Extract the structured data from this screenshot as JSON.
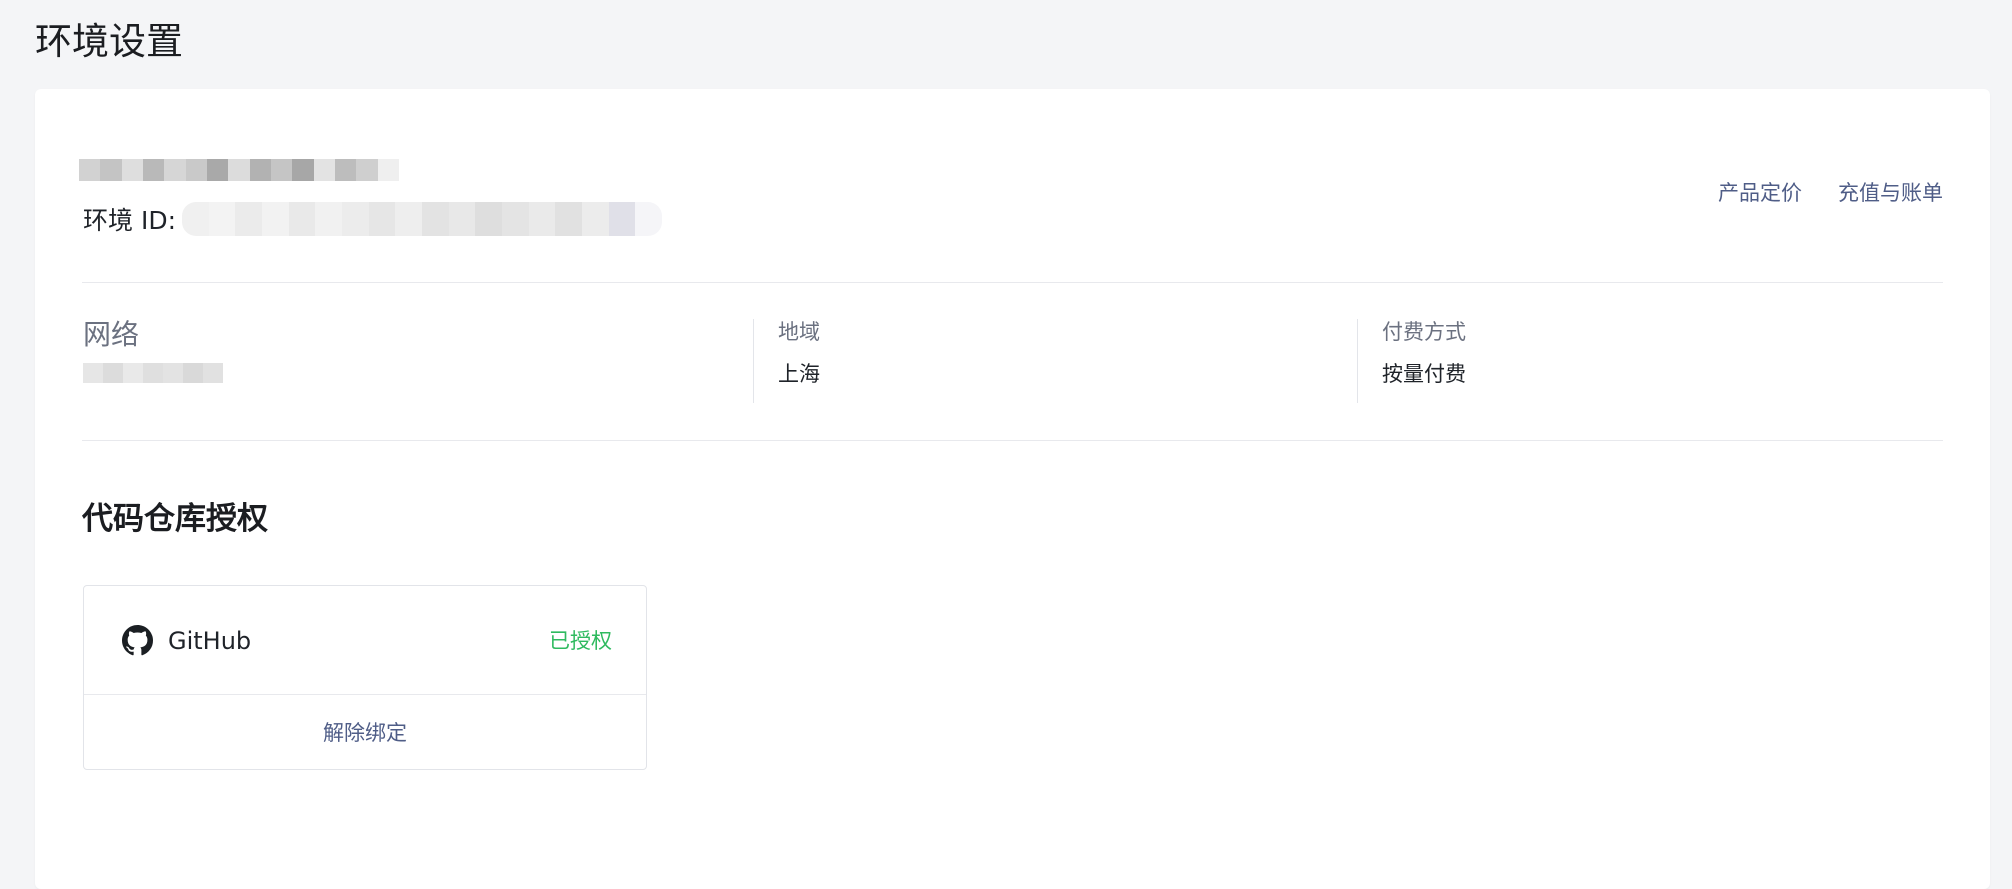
{
  "page": {
    "title": "环境设置"
  },
  "header": {
    "env_id_label": "环境 ID:",
    "links": {
      "pricing": "产品定价",
      "billing": "充值与账单"
    }
  },
  "info": {
    "network_label": "网络",
    "region_label": "地域",
    "region_value": "上海",
    "billing_label": "付费方式",
    "billing_value": "按量付费"
  },
  "repo_section": {
    "title": "代码仓库授权",
    "provider": {
      "icon": "github-icon",
      "name": "GitHub",
      "status": "已授权",
      "status_color": "#2fba5f",
      "action": "解除绑定"
    }
  },
  "colors": {
    "link": "#4f5d87",
    "background": "#f4f5f7",
    "card": "#ffffff"
  }
}
